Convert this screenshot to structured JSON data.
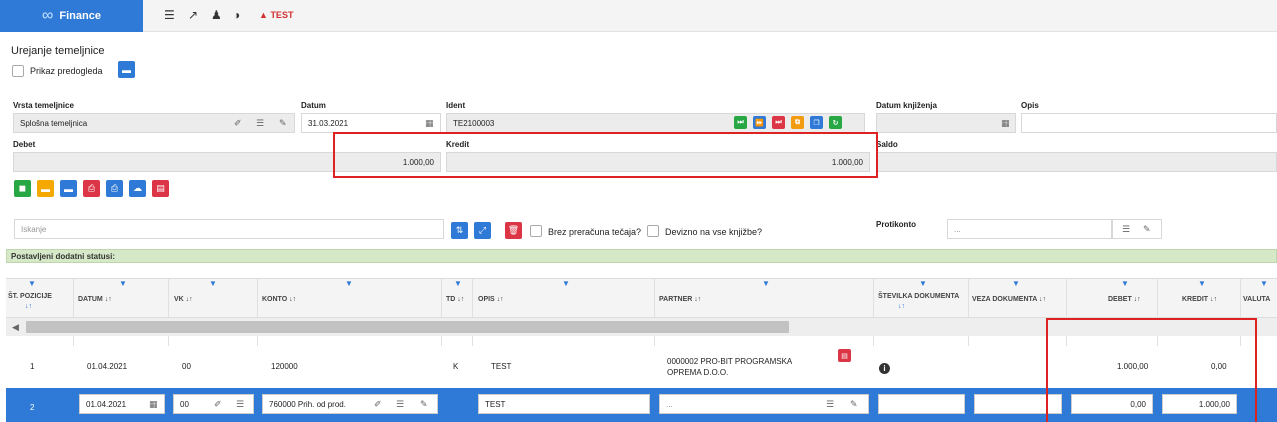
{
  "app": {
    "name": "Finance",
    "test_label": "TEST"
  },
  "page": {
    "title": "Urejanje temeljnice",
    "preview_label": "Prikaz predogleda"
  },
  "form": {
    "vrsta_label": "Vrsta temeljnice",
    "vrsta_value": "Splošna temeljnica",
    "datum_label": "Datum",
    "datum_value": "31.03.2021",
    "ident_label": "Ident",
    "ident_value": "TE2100003",
    "datum_knjizenja_label": "Datum knjiženja",
    "opis_label": "Opis",
    "debet_label": "Debet",
    "debet_value": "1.000,00",
    "kredit_label": "Kredit",
    "kredit_value": "1.000,00",
    "saldo_label": "Saldo"
  },
  "search": {
    "placeholder": "Iskanje",
    "brez_label": "Brez preračuna tečaja?",
    "devizno_label": "Devizno na vse knjižbe?",
    "protikonto_label": "Protikonto",
    "protikonto_value": "..."
  },
  "status_bar": "Postavljeni dodatni statusi:",
  "columns": {
    "pozicija_a": "ŠT. POZICIJE",
    "pozicija_b": "↓↑",
    "datum": "DATUM ↓↑",
    "vk": "VK ↓↑",
    "konto": "KONTO ↓↑",
    "td": "TD ↓↑",
    "opis": "OPIS ↓↑",
    "partner": "PARTNER ↓↑",
    "stevilka_a": "ŠTEVILKA DOKUMENTA",
    "stevilka_b": "↓↑",
    "veza": "VEZA DOKUMENTA ↓↑",
    "debet": "DEBET ↓↑",
    "kredit": "KREDIT ↓↑",
    "valuta": "VALUTA"
  },
  "rows": [
    {
      "pos": "1",
      "datum": "01.04.2021",
      "vk": "00",
      "konto": "120000",
      "td": "K",
      "opis": "TEST",
      "partner_a": "0000002 PRO-BIT PROGRAMSKA",
      "partner_b": "OPREMA D.O.O.",
      "debet": "1.000,00",
      "kredit": "0,00"
    },
    {
      "pos": "2",
      "datum": "01.04.2021",
      "vk": "00",
      "konto": "760000 Prih. od prod.",
      "opis": "TEST",
      "partner": "...",
      "debet": "0,00",
      "kredit": "1.000,00"
    }
  ],
  "colors": {
    "accent": "#2e7ad6",
    "highlight": "#dd2222",
    "status_green": "#d5e8c8"
  }
}
